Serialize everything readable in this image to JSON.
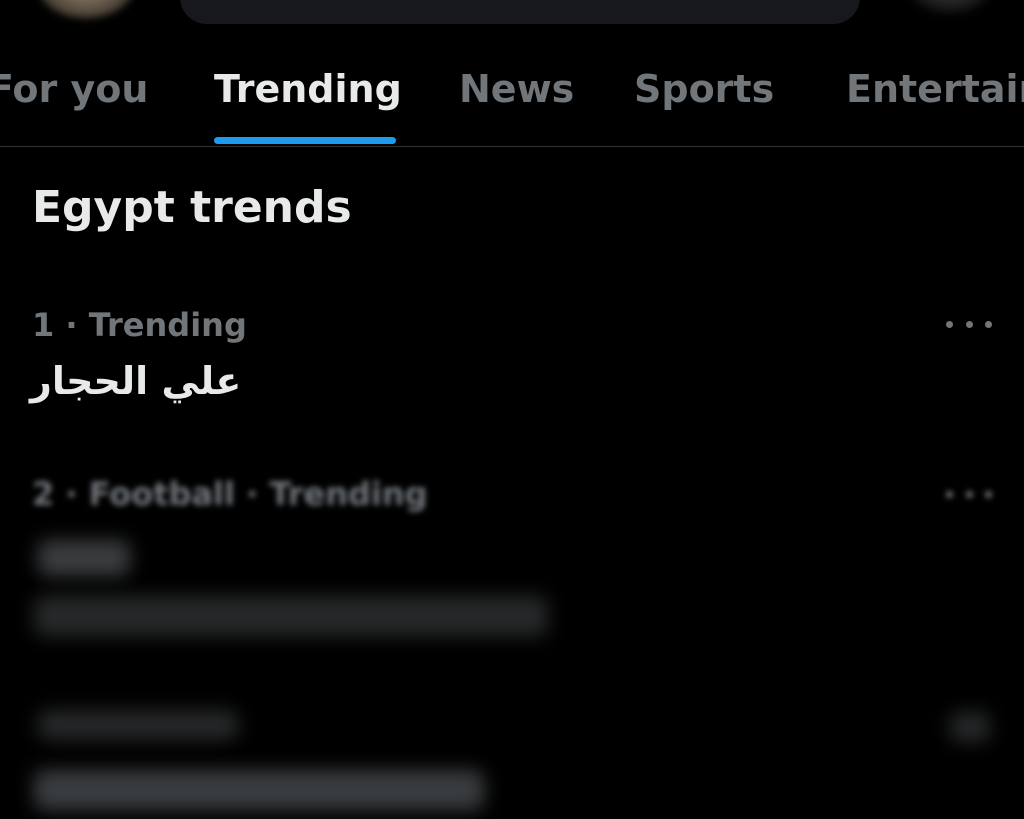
{
  "tabs": [
    {
      "label": "For you"
    },
    {
      "label": "Trending"
    },
    {
      "label": "News"
    },
    {
      "label": "Sports"
    },
    {
      "label": "Entertain"
    }
  ],
  "active_tab": "Trending",
  "section": {
    "title": "Egypt trends"
  },
  "trends": [
    {
      "meta": "1 · Trending",
      "name": "علي الحجار"
    },
    {
      "meta": "2 · Football · Trending"
    }
  ],
  "colors": {
    "background": "#000000",
    "primary_text": "#e7e9ea",
    "secondary_text": "#71767b",
    "accent": "#1d9bf0",
    "divider": "#2f3336"
  },
  "icons": {
    "more": "more-horizontal-icon"
  }
}
